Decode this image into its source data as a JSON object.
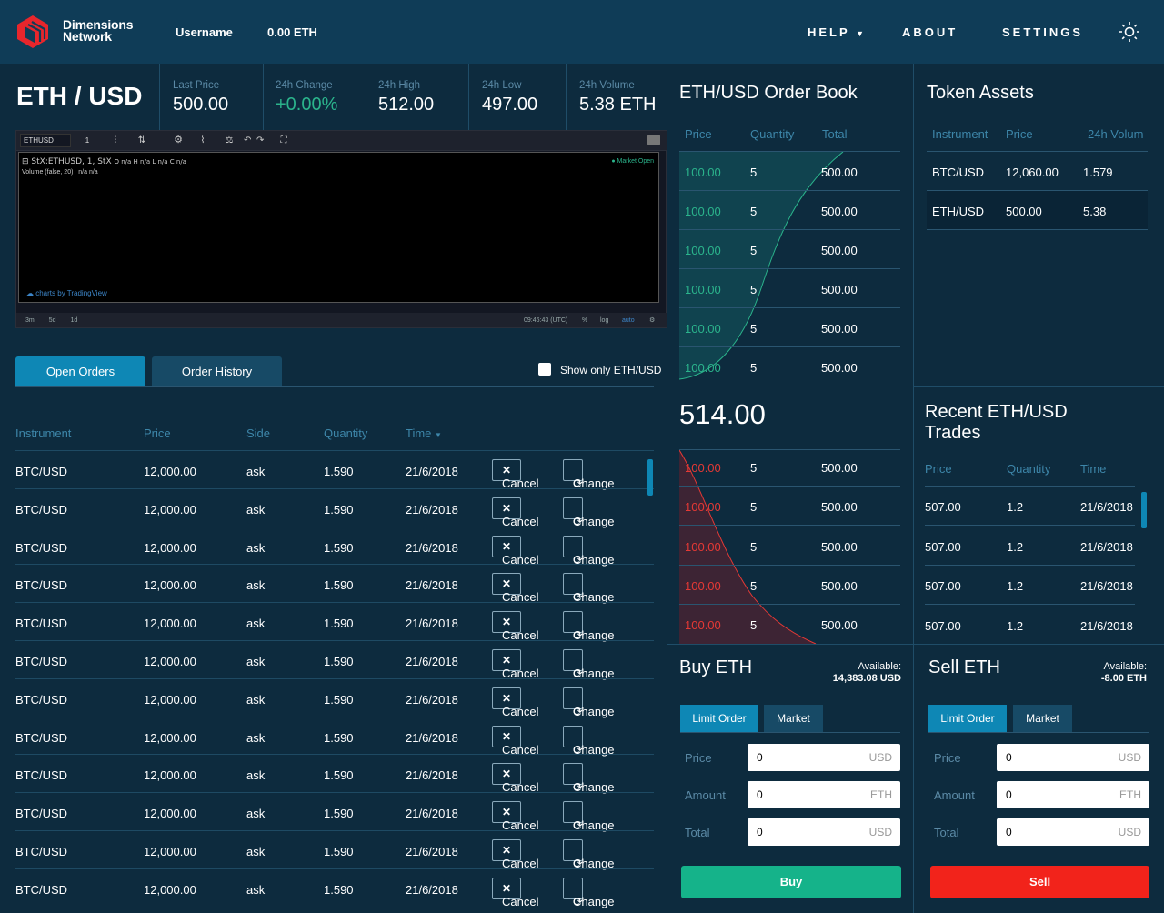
{
  "header": {
    "brand_line1": "Dimensions",
    "brand_line2": "Network",
    "username": "Username",
    "balance": "0.00 ETH",
    "nav": {
      "help": "HELP",
      "about": "ABOUT",
      "settings": "SETTINGS"
    }
  },
  "market": {
    "pair": "ETH / USD",
    "stats": [
      {
        "label": "Last Price",
        "value": "500.00"
      },
      {
        "label": "24h Change",
        "value": "+0.00%"
      },
      {
        "label": "24h High",
        "value": "512.00"
      },
      {
        "label": "24h Low",
        "value": "497.00"
      },
      {
        "label": "24h Volume",
        "value": "5.38 ETH"
      }
    ]
  },
  "tradingview": {
    "symbol": "ETHUSD",
    "interval": "1",
    "legend": "StX:ETHUSD, 1, StX",
    "ohlc": "O n/a H n/a L n/a C n/a",
    "volume": "Volume (false, 20)",
    "volume_val": "n/a n/a",
    "status": "Market Open",
    "credit": "charts by TradingView",
    "ranges": [
      "3m",
      "5d",
      "1d"
    ],
    "clock": "09:46:43 (UTC)",
    "pct": "%",
    "log": "log",
    "auto": "auto"
  },
  "orders": {
    "tabs": [
      "Open Orders",
      "Order History"
    ],
    "filter_label": "Show only ETH/USD",
    "columns": [
      "Instrument",
      "Price",
      "Side",
      "Quantity",
      "Time"
    ],
    "cancel_label": "Cancel",
    "change_label": "Change",
    "rows": [
      [
        "BTC/USD",
        "12,000.00",
        "ask",
        "1.590",
        "21/6/2018"
      ],
      [
        "BTC/USD",
        "12,000.00",
        "ask",
        "1.590",
        "21/6/2018"
      ],
      [
        "BTC/USD",
        "12,000.00",
        "ask",
        "1.590",
        "21/6/2018"
      ],
      [
        "BTC/USD",
        "12,000.00",
        "ask",
        "1.590",
        "21/6/2018"
      ],
      [
        "BTC/USD",
        "12,000.00",
        "ask",
        "1.590",
        "21/6/2018"
      ],
      [
        "BTC/USD",
        "12,000.00",
        "ask",
        "1.590",
        "21/6/2018"
      ],
      [
        "BTC/USD",
        "12,000.00",
        "ask",
        "1.590",
        "21/6/2018"
      ],
      [
        "BTC/USD",
        "12,000.00",
        "ask",
        "1.590",
        "21/6/2018"
      ],
      [
        "BTC/USD",
        "12,000.00",
        "ask",
        "1.590",
        "21/6/2018"
      ],
      [
        "BTC/USD",
        "12,000.00",
        "ask",
        "1.590",
        "21/6/2018"
      ],
      [
        "BTC/USD",
        "12,000.00",
        "ask",
        "1.590",
        "21/6/2018"
      ],
      [
        "BTC/USD",
        "12,000.00",
        "ask",
        "1.590",
        "21/6/2018"
      ]
    ]
  },
  "orderbook": {
    "title": "ETH/USD Order Book",
    "columns": [
      "Price",
      "Quantity",
      "Total"
    ],
    "bids": [
      [
        "100.00",
        "5",
        "500.00"
      ],
      [
        "100.00",
        "5",
        "500.00"
      ],
      [
        "100.00",
        "5",
        "500.00"
      ],
      [
        "100.00",
        "5",
        "500.00"
      ],
      [
        "100.00",
        "5",
        "500.00"
      ],
      [
        "100.00",
        "5",
        "500.00"
      ]
    ],
    "mid": "514.00",
    "asks": [
      [
        "100.00",
        "5",
        "500.00"
      ],
      [
        "100.00",
        "5",
        "500.00"
      ],
      [
        "100.00",
        "5",
        "500.00"
      ],
      [
        "100.00",
        "5",
        "500.00"
      ],
      [
        "100.00",
        "5",
        "500.00"
      ]
    ]
  },
  "assets": {
    "title": "Token Assets",
    "columns": [
      "Instrument",
      "Price",
      "24h Volum"
    ],
    "rows": [
      [
        "BTC/USD",
        "12,060.00",
        "1.579"
      ],
      [
        "ETH/USD",
        "500.00",
        "5.38"
      ]
    ]
  },
  "trades": {
    "title1": "Recent ETH/USD",
    "title2": "Trades",
    "columns": [
      "Price",
      "Quantity",
      "Time"
    ],
    "rows": [
      [
        "507.00",
        "1.2",
        "21/6/2018"
      ],
      [
        "507.00",
        "1.2",
        "21/6/2018"
      ],
      [
        "507.00",
        "1.2",
        "21/6/2018"
      ],
      [
        "507.00",
        "1.2",
        "21/6/2018"
      ]
    ]
  },
  "buy": {
    "title": "Buy ETH",
    "avail_label": "Available:",
    "avail": "14,383.08 USD",
    "tabs": [
      "Limit Order",
      "Market"
    ],
    "fields": [
      {
        "label": "Price",
        "value": "0",
        "unit": "USD"
      },
      {
        "label": "Amount",
        "value": "0",
        "unit": "ETH"
      },
      {
        "label": "Total",
        "value": "0",
        "unit": "USD"
      }
    ],
    "button": "Buy"
  },
  "sell": {
    "title": "Sell ETH",
    "avail_label": "Available:",
    "avail": "-8.00 ETH",
    "tabs": [
      "Limit Order",
      "Market"
    ],
    "fields": [
      {
        "label": "Price",
        "value": "0",
        "unit": "USD"
      },
      {
        "label": "Amount",
        "value": "0",
        "unit": "ETH"
      },
      {
        "label": "Total",
        "value": "0",
        "unit": "USD"
      }
    ],
    "button": "Sell"
  },
  "colors": {
    "bg": "#0d2b3e",
    "header": "#0f3c57",
    "accent": "#0e87b5",
    "bid": "#2bb48c",
    "ask": "#e53935",
    "buy": "#15b38a",
    "sell": "#f2231b"
  }
}
